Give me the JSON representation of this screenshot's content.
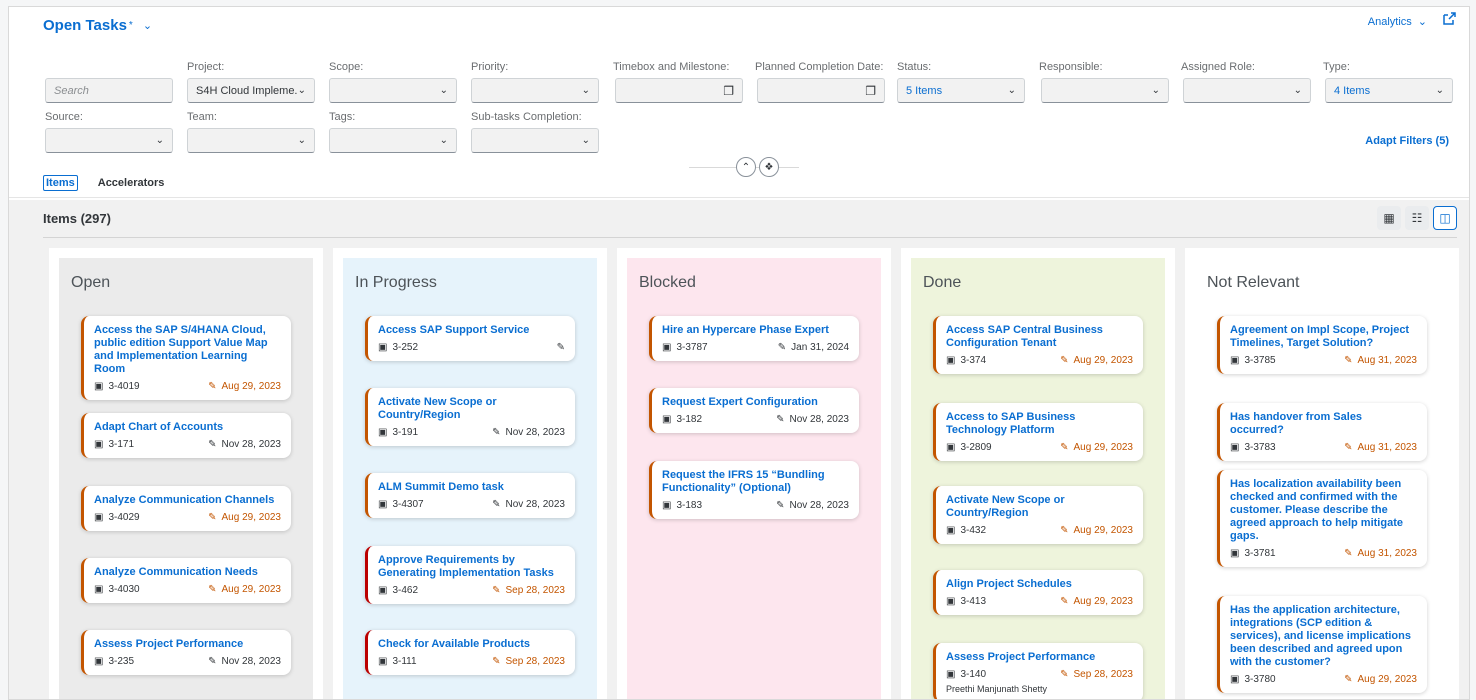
{
  "header": {
    "title": "Open Tasks",
    "title_marker": "*",
    "analytics": "Analytics"
  },
  "filters": {
    "search_placeholder": "Search",
    "project": {
      "label": "Project:",
      "value": "S4H Cloud Impleme..."
    },
    "scope": {
      "label": "Scope:",
      "value": ""
    },
    "priority": {
      "label": "Priority:",
      "value": ""
    },
    "timebox": {
      "label": "Timebox and Milestone:",
      "value": ""
    },
    "planned": {
      "label": "Planned Completion Date:",
      "value": ""
    },
    "status": {
      "label": "Status:",
      "value": "5 Items"
    },
    "responsible": {
      "label": "Responsible:",
      "value": ""
    },
    "assigned_role": {
      "label": "Assigned Role:",
      "value": ""
    },
    "type": {
      "label": "Type:",
      "value": "4 Items"
    },
    "source": {
      "label": "Source:",
      "value": ""
    },
    "team": {
      "label": "Team:",
      "value": ""
    },
    "tags": {
      "label": "Tags:",
      "value": ""
    },
    "subtasks": {
      "label": "Sub-tasks Completion:",
      "value": ""
    },
    "adapt": "Adapt Filters (5)"
  },
  "tabs": {
    "items": "Items",
    "accelerators": "Accelerators"
  },
  "items_title": "Items (297)",
  "colors": {
    "open": "#ebebeb",
    "in_progress": "#e6f3fb",
    "blocked": "#fde6ee",
    "done": "#eef4dc",
    "not_relevant": "#ffffff",
    "accent": "#0a6ed1",
    "late": "#c35500"
  },
  "columns": [
    {
      "title": "Open",
      "cards": [
        {
          "title": "Access the SAP S/4HANA Cloud, public edition Support Value Map and Implementation Learning Room",
          "id": "3-4019",
          "date": "Aug 29, 2023",
          "late": true
        },
        {
          "title": "Adapt Chart of Accounts",
          "id": "3-171",
          "date": "Nov 28, 2023",
          "late": false
        },
        {
          "title": "Analyze Communication Channels",
          "id": "3-4029",
          "date": "Aug 29, 2023",
          "late": true
        },
        {
          "title": "Analyze Communication Needs",
          "id": "3-4030",
          "date": "Aug 29, 2023",
          "late": true
        },
        {
          "title": "Assess Project Performance",
          "id": "3-235",
          "date": "Nov 28, 2023",
          "late": false
        }
      ]
    },
    {
      "title": "In Progress",
      "cards": [
        {
          "title": "Access SAP Support Service",
          "id": "3-252",
          "date": "",
          "late": false
        },
        {
          "title": "Activate New Scope or Country/Region",
          "id": "3-191",
          "date": "Nov 28, 2023",
          "late": false
        },
        {
          "title": "ALM Summit Demo task",
          "id": "3-4307",
          "date": "Nov 28, 2023",
          "late": false
        },
        {
          "title": "Approve Requirements by Generating Implementation Tasks",
          "id": "3-462",
          "date": "Sep 28, 2023",
          "late": true
        },
        {
          "title": "Check for Available Products",
          "id": "3-111",
          "date": "Sep 28, 2023",
          "late": true
        }
      ]
    },
    {
      "title": "Blocked",
      "cards": [
        {
          "title": "Hire an Hypercare Phase Expert",
          "id": "3-3787",
          "date": "Jan 31, 2024",
          "late": false
        },
        {
          "title": "Request Expert Configuration",
          "id": "3-182",
          "date": "Nov 28, 2023",
          "late": false
        },
        {
          "title": "Request the IFRS 15 “Bundling Functionality” (Optional)",
          "id": "3-183",
          "date": "Nov 28, 2023",
          "late": false
        }
      ]
    },
    {
      "title": "Done",
      "cards": [
        {
          "title": "Access SAP Central Business Configuration Tenant",
          "id": "3-374",
          "date": "Aug 29, 2023",
          "late": true
        },
        {
          "title": "Access to SAP Business Technology Platform",
          "id": "3-2809",
          "date": "Aug 29, 2023",
          "late": true
        },
        {
          "title": "Activate New Scope or Country/Region",
          "id": "3-432",
          "date": "Aug 29, 2023",
          "late": true
        },
        {
          "title": "Align Project Schedules",
          "id": "3-413",
          "date": "Aug 29, 2023",
          "late": true
        },
        {
          "title": "Assess Project Performance",
          "id": "3-140",
          "date": "Sep 28, 2023",
          "late": true,
          "person": "Preethi Manjunath Shetty"
        }
      ]
    },
    {
      "title": "Not Relevant",
      "cards": [
        {
          "title": "Agreement on Impl Scope, Project Timelines, Target Solution?",
          "id": "3-3785",
          "date": "Aug 31, 2023",
          "late": true
        },
        {
          "title": "Has handover from Sales occurred?",
          "id": "3-3783",
          "date": "Aug 31, 2023",
          "late": true
        },
        {
          "title": "Has localization availability been checked and confirmed with the customer. Please describe the agreed approach to help mitigate gaps.",
          "id": "3-3781",
          "date": "Aug 31, 2023",
          "late": true
        },
        {
          "title": "Has the application architecture, integrations (SCP edition & services), and license implications been described and agreed upon with the customer?",
          "id": "3-3780",
          "date": "Aug 29, 2023",
          "late": true
        }
      ]
    }
  ]
}
